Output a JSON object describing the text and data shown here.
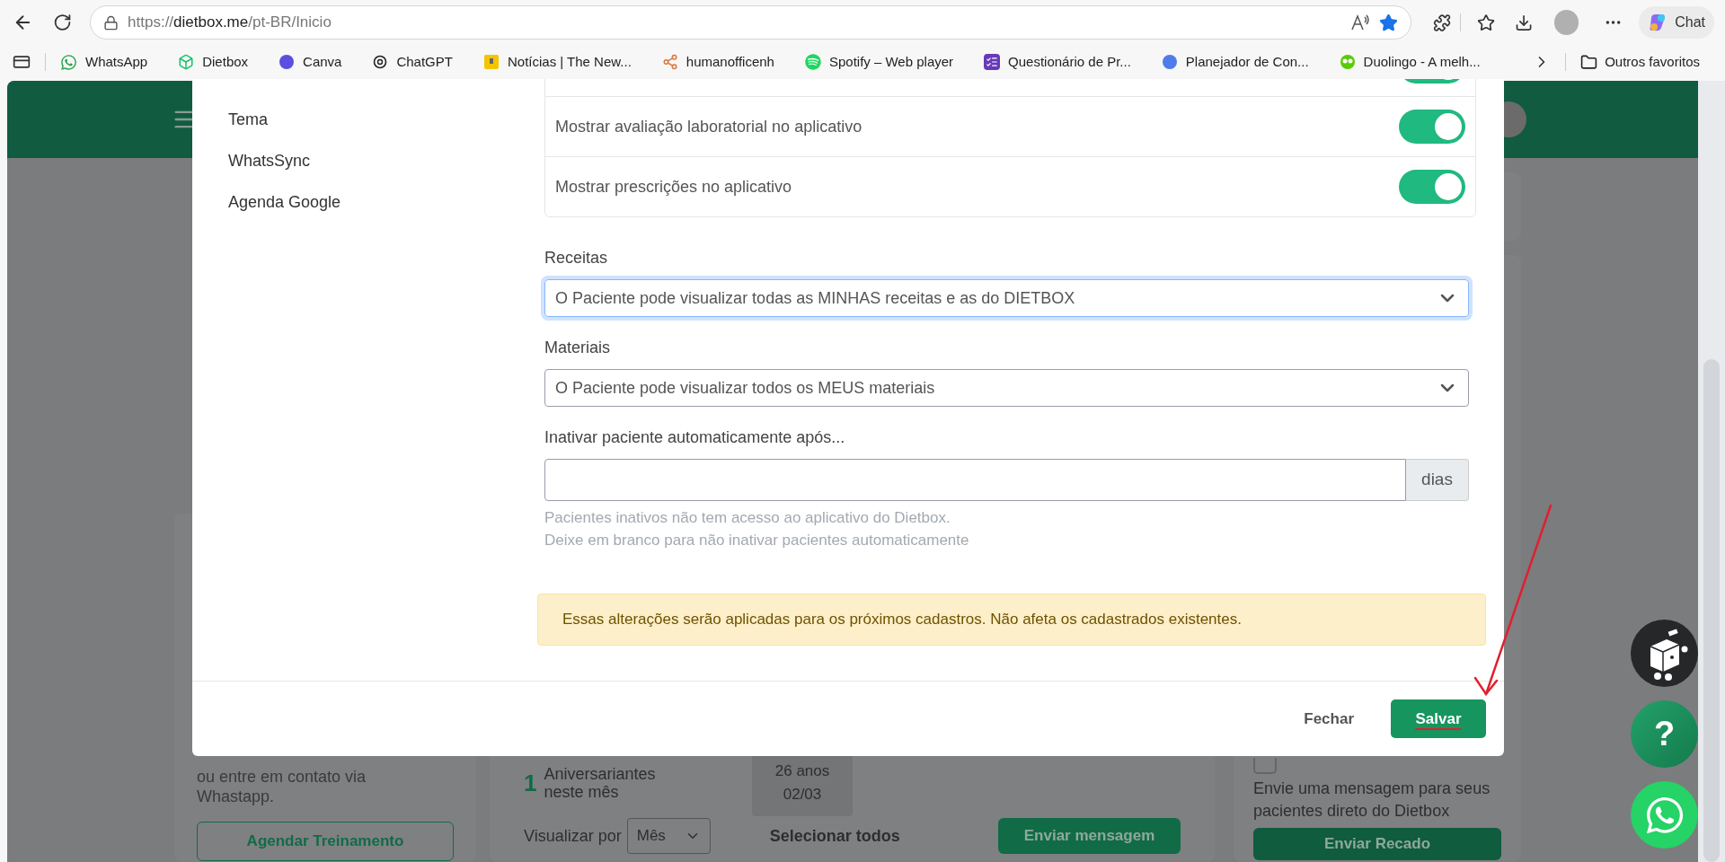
{
  "browser": {
    "url_scheme": "https://",
    "url_host": "dietbox.me",
    "url_path": "/pt-BR/Inicio",
    "favorited": true,
    "chat_label": "Chat",
    "bookmarks": [
      {
        "label": "WhatsApp"
      },
      {
        "label": "Dietbox"
      },
      {
        "label": "Canva"
      },
      {
        "label": "ChatGPT"
      },
      {
        "label": "Notícias | The New..."
      },
      {
        "label": "humanofficenh"
      },
      {
        "label": "Spotify – Web player"
      },
      {
        "label": "Questionário de Pr..."
      },
      {
        "label": "Planejador de Con..."
      },
      {
        "label": "Duolingo - A melh..."
      }
    ],
    "other_bookmarks": "Outros favoritos"
  },
  "background": {
    "help_card": {
      "text": "ou entre em contato via Whastapp.",
      "button": "Agendar Treinamento"
    },
    "birthdays": {
      "count": "1",
      "label": "Aniversariantes neste mês",
      "age": "26 anos",
      "date": "02/03",
      "view_label": "Visualizar por",
      "view_value": "Mês",
      "select_all": "Selecionar todos",
      "button": "Enviar mensagem"
    },
    "messages": {
      "text": "Envie uma mensagem para seus pacientes direto do Dietbox",
      "button": "Enviar Recado"
    },
    "help_button": "?"
  },
  "modal": {
    "nav": [
      {
        "label": "Tema"
      },
      {
        "label": "WhatsSync"
      },
      {
        "label": "Agenda Google"
      }
    ],
    "toggles": [
      {
        "on": true
      },
      {
        "label": "Mostrar avaliação laboratorial no aplicativo",
        "on": true
      },
      {
        "label": "Mostrar prescrições no aplicativo",
        "on": true
      }
    ],
    "fields": [
      {
        "kind": "select",
        "label": "Receitas",
        "value": "O Paciente pode visualizar todas as MINHAS receitas e as do DIETBOX",
        "focused": true
      },
      {
        "kind": "select",
        "label": "Materiais",
        "value": "O Paciente pode visualizar todos os MEUS materiais",
        "focused": false
      },
      {
        "kind": "addon",
        "label": "Inativar paciente automaticamente após...",
        "addon": "dias",
        "help": [
          "Pacientes inativos não tem acesso ao aplicativo do Dietbox.",
          "Deixe em branco para não inativar pacientes automaticamente"
        ]
      }
    ],
    "alert": "Essas alterações serão aplicadas para os próximos cadastros. Não afeta os cadastrados existentes.",
    "buttons": [
      {
        "label": "Fechar",
        "kind": "secondary"
      },
      {
        "label": "Salvar",
        "kind": "primary"
      }
    ]
  }
}
